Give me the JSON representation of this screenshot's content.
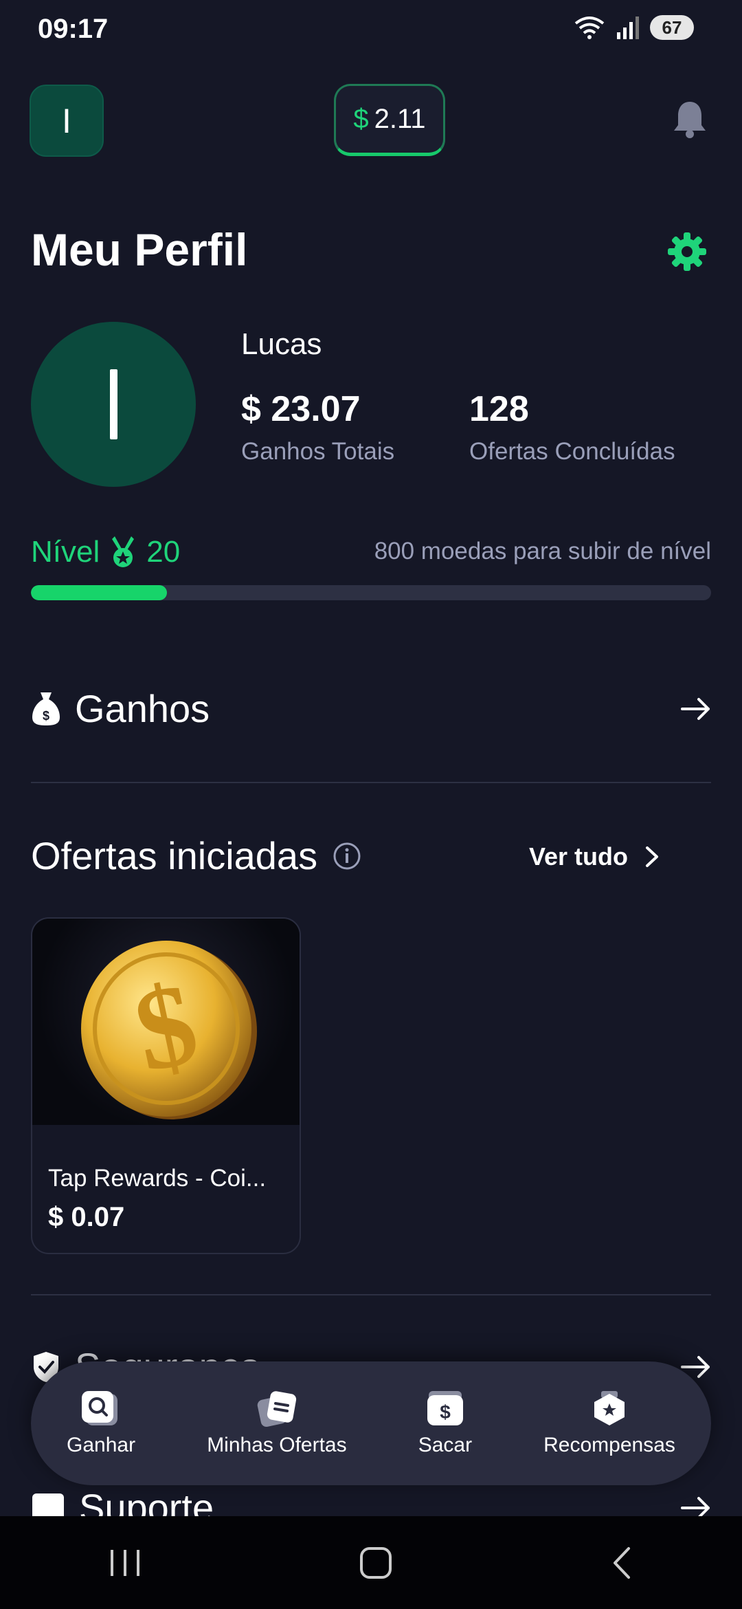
{
  "status_bar": {
    "time": "09:17",
    "battery": "67"
  },
  "header": {
    "avatar_initial": "I",
    "balance_currency": "$",
    "balance_value": "2.11"
  },
  "page": {
    "title": "Meu Perfil"
  },
  "profile": {
    "name": "Lucas",
    "total_earnings": "$ 23.07",
    "total_earnings_label": "Ganhos Totais",
    "offers_completed": "128",
    "offers_completed_label": "Ofertas Concluídas"
  },
  "level": {
    "label": "Nível",
    "value": "20",
    "info": "800 moedas para subir de nível",
    "progress_fraction": 0.2
  },
  "sections": {
    "earnings": "Ganhos",
    "started_offers": "Ofertas iniciadas",
    "see_all": "Ver tudo",
    "security": "Segurança",
    "support": "Suporte"
  },
  "offers": [
    {
      "name": "Tap Rewards - Coi...",
      "price": "$ 0.07"
    }
  ],
  "bottom_nav": [
    {
      "label": "Ganhar",
      "icon": "search-icon"
    },
    {
      "label": "Minhas Ofertas",
      "icon": "offers-icon"
    },
    {
      "label": "Sacar",
      "icon": "wallet-icon"
    },
    {
      "label": "Recompensas",
      "icon": "rewards-icon"
    }
  ],
  "colors": {
    "accent": "#1fd47a",
    "background": "#151726",
    "avatar": "#0b4a3d"
  }
}
